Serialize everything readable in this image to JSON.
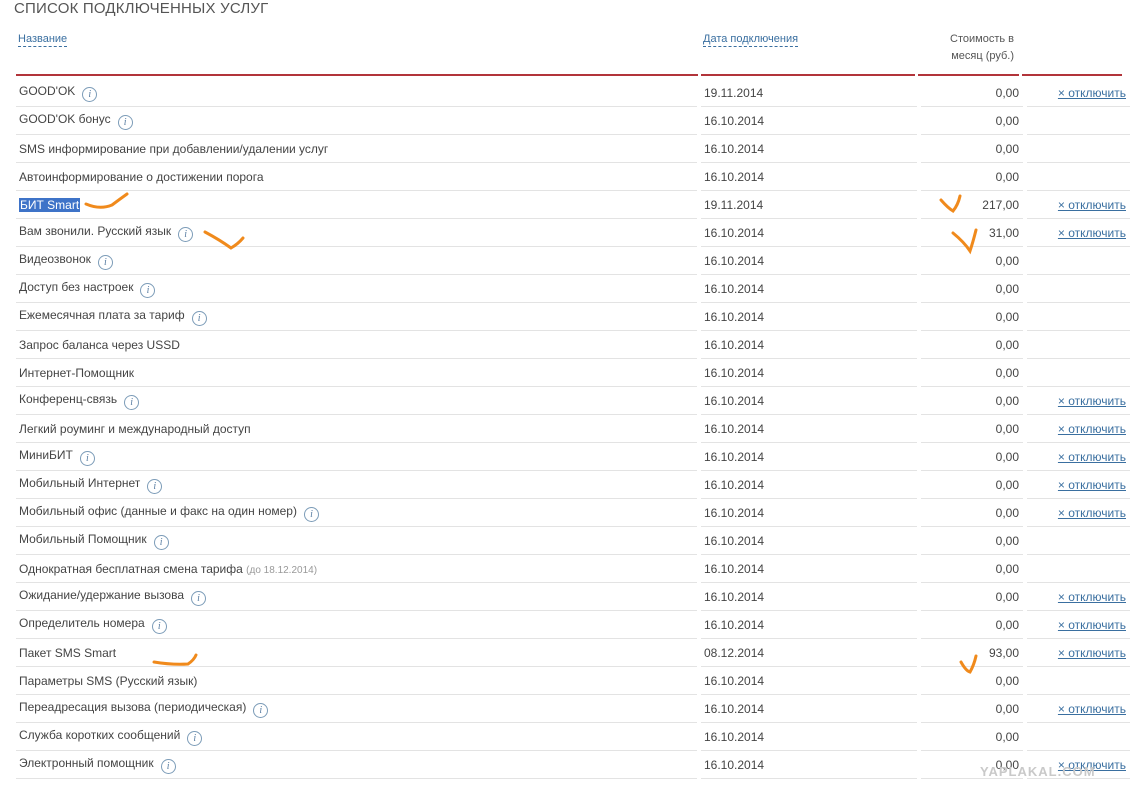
{
  "page_title": "СПИСОК ПОДКЛЮЧЕННЫХ УСЛУГ",
  "headers": {
    "name": "Название",
    "date": "Дата подключения",
    "cost_line1": "Стоимость в",
    "cost_line2": "месяц (руб.)"
  },
  "disable_label": "× отключить",
  "info_glyph": "i",
  "watermark": "YAPLAKAL.COM",
  "colors": {
    "accent": "#b2343a",
    "link": "#3a6fa0",
    "highlight": "#3e73c8",
    "marker": "#f08a1c"
  },
  "services": [
    {
      "name": "GOOD'OK",
      "info": true,
      "date": "19.11.2014",
      "cost": "0,00",
      "disable": true
    },
    {
      "name": "GOOD'OK бонус",
      "info": true,
      "date": "16.10.2014",
      "cost": "0,00",
      "disable": false
    },
    {
      "name": "SMS информирование при добавлении/удалении услуг",
      "info": false,
      "date": "16.10.2014",
      "cost": "0,00",
      "disable": false
    },
    {
      "name": "Автоинформирование о достижении порога",
      "info": false,
      "date": "16.10.2014",
      "cost": "0,00",
      "disable": false
    },
    {
      "name": "БИТ Smart",
      "info": false,
      "selected": true,
      "date": "19.11.2014",
      "cost": "217,00",
      "disable": true
    },
    {
      "name": "Вам звонили. Русский язык",
      "info": true,
      "date": "16.10.2014",
      "cost": "31,00",
      "disable": true
    },
    {
      "name": "Видеозвонок",
      "info": true,
      "date": "16.10.2014",
      "cost": "0,00",
      "disable": false
    },
    {
      "name": "Доступ без настроек",
      "info": true,
      "date": "16.10.2014",
      "cost": "0,00",
      "disable": false
    },
    {
      "name": "Ежемесячная плата за тариф",
      "info": true,
      "date": "16.10.2014",
      "cost": "0,00",
      "disable": false
    },
    {
      "name": "Запрос баланса через USSD",
      "info": false,
      "date": "16.10.2014",
      "cost": "0,00",
      "disable": false
    },
    {
      "name": "Интернет-Помощник",
      "info": false,
      "date": "16.10.2014",
      "cost": "0,00",
      "disable": false
    },
    {
      "name": "Конференц-связь",
      "info": true,
      "date": "16.10.2014",
      "cost": "0,00",
      "disable": true
    },
    {
      "name": "Легкий роуминг и международный доступ",
      "info": false,
      "date": "16.10.2014",
      "cost": "0,00",
      "disable": true
    },
    {
      "name": "МиниБИТ",
      "info": true,
      "date": "16.10.2014",
      "cost": "0,00",
      "disable": true
    },
    {
      "name": "Мобильный Интернет",
      "info": true,
      "date": "16.10.2014",
      "cost": "0,00",
      "disable": true
    },
    {
      "name": "Мобильный офис (данные и факс на один номер)",
      "info": true,
      "date": "16.10.2014",
      "cost": "0,00",
      "disable": true
    },
    {
      "name": "Мобильный Помощник",
      "info": true,
      "date": "16.10.2014",
      "cost": "0,00",
      "disable": false
    },
    {
      "name": "Однократная бесплатная смена тарифа",
      "note": "(до 18.12.2014)",
      "info": false,
      "date": "16.10.2014",
      "cost": "0,00",
      "disable": false
    },
    {
      "name": "Ожидание/удержание вызова",
      "info": true,
      "date": "16.10.2014",
      "cost": "0,00",
      "disable": true
    },
    {
      "name": "Определитель номера",
      "info": true,
      "date": "16.10.2014",
      "cost": "0,00",
      "disable": true
    },
    {
      "name": "Пакет SMS Smart",
      "info": false,
      "date": "08.12.2014",
      "cost": "93,00",
      "disable": true
    },
    {
      "name": "Параметры SMS (Русский язык)",
      "info": false,
      "date": "16.10.2014",
      "cost": "0,00",
      "disable": false
    },
    {
      "name": "Переадресация вызова (периодическая)",
      "info": true,
      "date": "16.10.2014",
      "cost": "0,00",
      "disable": true
    },
    {
      "name": "Служба коротких сообщений",
      "info": true,
      "date": "16.10.2014",
      "cost": "0,00",
      "disable": false
    },
    {
      "name": "Электронный помощник",
      "info": true,
      "date": "16.10.2014",
      "cost": "0,00",
      "disable": true
    }
  ]
}
